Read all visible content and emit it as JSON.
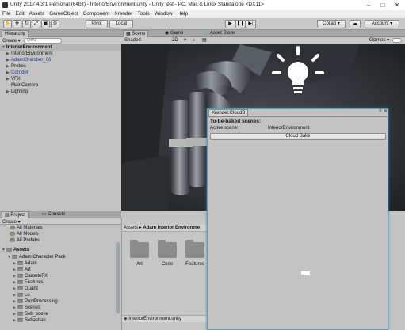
{
  "window": {
    "title": "Unity 2017.4.3f1 Personal (64bit) - InteriorEnvironment.unity - Unity test - PC, Mac & Linux Standalone <DX11>"
  },
  "menu": [
    "File",
    "Edit",
    "Assets",
    "GameObject",
    "Component",
    "Xrender",
    "Tools",
    "Window",
    "Help"
  ],
  "toolbar": {
    "pivot": "Pivot",
    "local": "Local",
    "collab": "Collab ▾",
    "account": "Account ▾"
  },
  "hierarchy": {
    "tab": "Hierarchy",
    "create": "Create ▾",
    "search_placeholder": "Q▾All",
    "scene": "InteriorEnvironment",
    "items": [
      "InteriorEnvironment",
      "AdamChamber_06",
      "Probes",
      "Corridor",
      "VFX",
      "MainCamera",
      "Lighting"
    ]
  },
  "scene_tabs": {
    "scene": "Scene",
    "game": "Game",
    "asset_store": "Asset Store"
  },
  "scene_toolbar": {
    "shaded": "Shaded",
    "mode2d": "2D",
    "gizmos": "Gizmos ▾"
  },
  "xrender": {
    "tab": "Xrender.CloudB",
    "heading": "To-be-baked scenes:",
    "active_label": "Active scene:",
    "active_value": "InteriorEnvironment",
    "button": "Cloud Bake"
  },
  "project": {
    "tab": "Project",
    "console_tab": "Console",
    "create": "Create ▾",
    "favorites": [
      "All Materials",
      "All Models",
      "All Prefabs"
    ],
    "assets_root": "Assets",
    "tree": [
      "Adam Character Pack",
      "Adam",
      "Art",
      "CaronteFX",
      "Features",
      "Guard",
      "Lu",
      "PostProcessing",
      "Scenes",
      "Seb_scene",
      "Sebastian"
    ],
    "breadcrumb_root": "Assets",
    "breadcrumb_sep": "▸",
    "breadcrumb_current": "Adam Interior Environme",
    "folders": [
      "Art",
      "Code",
      "Features"
    ],
    "footer_file": "InteriorEnvironment.unity"
  }
}
